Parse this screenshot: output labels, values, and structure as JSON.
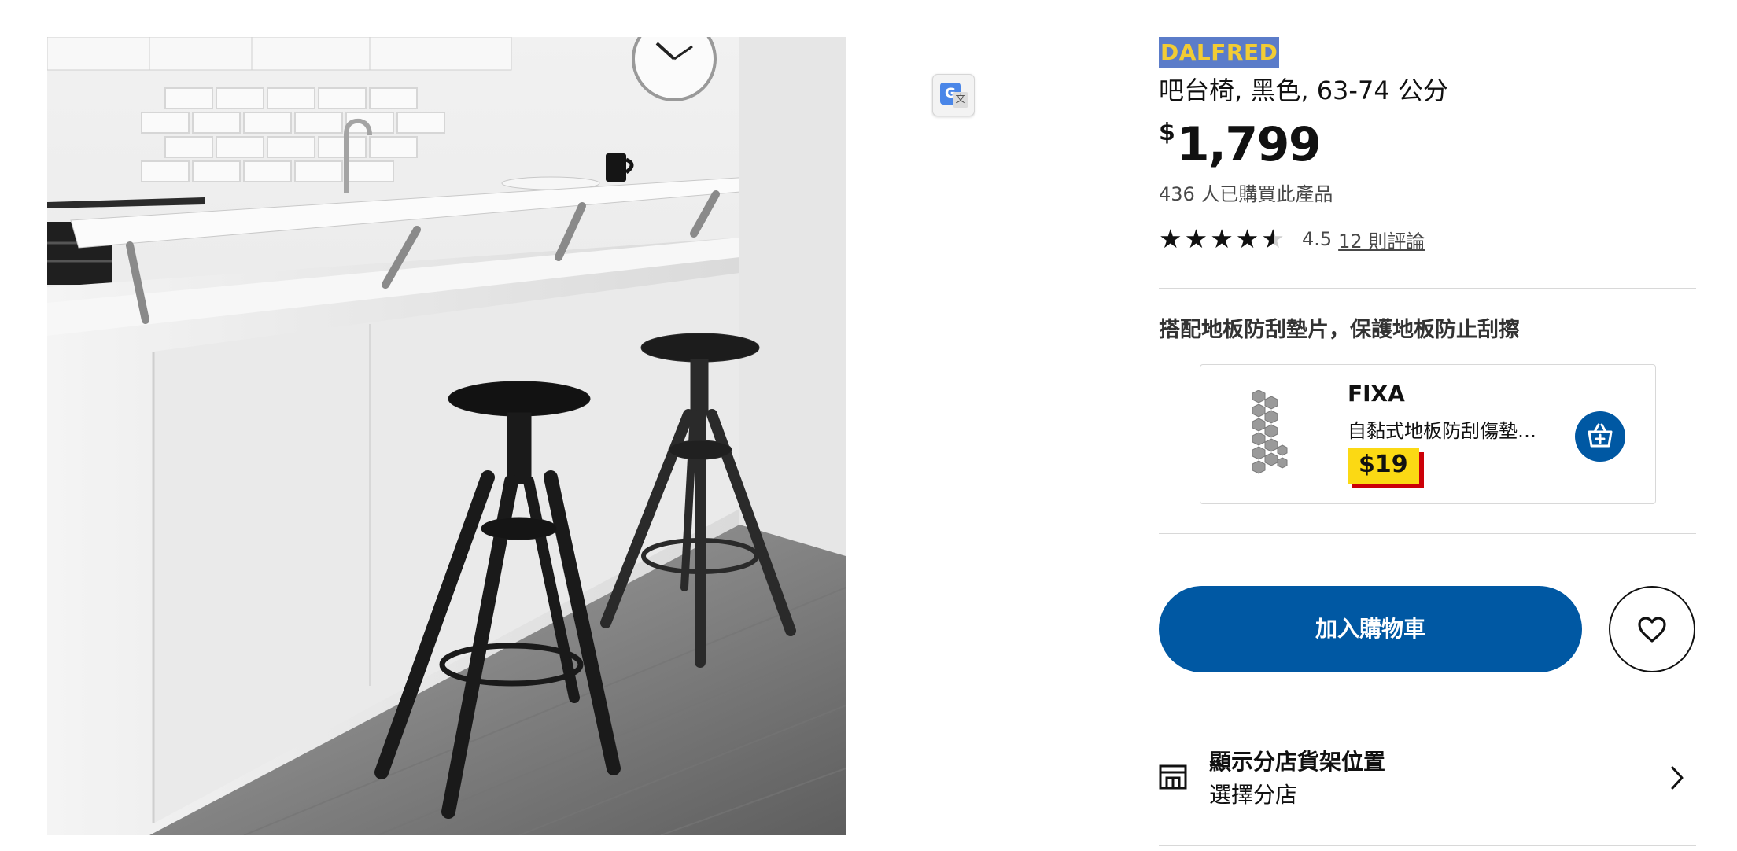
{
  "product": {
    "brand": "DALFRED",
    "subtitle": "吧台椅, 黑色, 63-74 公分",
    "currency": "$",
    "price": "1,799",
    "purchased": "436 人已購買此產品",
    "rating_value": "4.5",
    "rating_stars": 4.5,
    "reviews_link": "12 則評論",
    "image_icon": "bar-stool-photo"
  },
  "pairing": {
    "heading": "搭配地板防刮墊片，保護地板防止刮擦",
    "name": "FIXA",
    "description": "自黏式地板防刮傷墊片...",
    "price": "$19",
    "add_icon": "add-to-basket-icon"
  },
  "actions": {
    "add_to_cart": "加入購物車",
    "favorite_icon": "heart-icon"
  },
  "store": {
    "title": "顯示分店貨架位置",
    "subtitle": "選擇分店",
    "icon": "store-icon"
  },
  "translate": {
    "icon": "google-translate-icon"
  },
  "colors": {
    "brand_highlight_bg": "#5b7cc9",
    "brand_highlight_text": "#f2cc34",
    "primary_blue": "#0058a3",
    "price_tag_yellow": "#fbd914",
    "price_tag_red": "#cc0008"
  }
}
